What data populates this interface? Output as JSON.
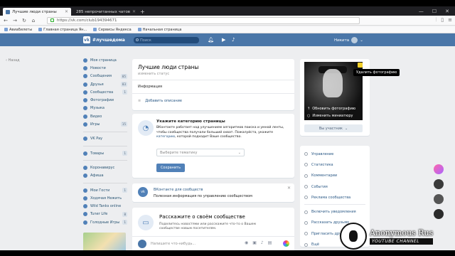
{
  "browser": {
    "tabs": [
      {
        "title": "Лучшие люди страны",
        "active": true
      },
      {
        "title": "285 непрочитанных чатов",
        "active": false
      }
    ],
    "url": "https://vk.com/club194394671",
    "bookmarks": [
      "Авиабилеты",
      "Главная страница Ян...",
      "Сервисы Яндекса",
      "Начальная страница"
    ]
  },
  "vk_header": {
    "logo_text": "#лучшедома",
    "search_placeholder": "Поиск",
    "user_name": "Никита"
  },
  "back_link": "Назад",
  "sidebar": {
    "items": [
      {
        "label": "Моя страница",
        "count": ""
      },
      {
        "label": "Новости",
        "count": ""
      },
      {
        "label": "Сообщения",
        "count": "85"
      },
      {
        "label": "Друзья",
        "count": "83"
      },
      {
        "label": "Сообщества",
        "count": "1"
      },
      {
        "label": "Фотографии",
        "count": ""
      },
      {
        "label": "Музыка",
        "count": ""
      },
      {
        "label": "Видео",
        "count": ""
      },
      {
        "label": "Игры",
        "count": "15"
      }
    ],
    "items2": [
      {
        "label": "VK Pay",
        "count": ""
      }
    ],
    "items3": [
      {
        "label": "Товары",
        "count": "1"
      }
    ],
    "items4": [
      {
        "label": "Коронавирус",
        "count": ""
      },
      {
        "label": "Афиша",
        "count": ""
      }
    ],
    "items5": [
      {
        "label": "Мои Гости",
        "count": "1"
      },
      {
        "label": "Ходячая Нежить",
        "count": ""
      },
      {
        "label": "Wild Tanks online",
        "count": ""
      },
      {
        "label": "Tuner Life",
        "count": "8"
      },
      {
        "label": "Голодные Игры",
        "count": "1"
      }
    ]
  },
  "group": {
    "name": "Лучшие люди страны",
    "status_placeholder": "изменить статус",
    "info_heading": "Информация",
    "add_description": "Добавить описание"
  },
  "category": {
    "heading": "Укажите категорию страницы",
    "text_before": "ВКонтакте работает над улучшением алгоритмов поиска и умной ленты, чтобы сообщества получали больший охват. Пожалуйста, укажите ",
    "text_link": "категорию",
    "text_after": ", которой подходит Ваше сообщество.",
    "select_placeholder": "Выберите тематику",
    "save_button": "Сохранить"
  },
  "vk_for_communities": {
    "title": "ВКонтакте для сообществ",
    "subtitle": "Полезная информация по управлению сообществом"
  },
  "tell": {
    "title": "Расскажите о своём сообществе",
    "text": "Поделитесь новостями или расскажите что-то о Вашем сообществе новым посетителям."
  },
  "post_placeholder": "Напишите что-нибудь...",
  "photo": {
    "update": "Обновить фотографию",
    "thumb": "Изменить миниатюру",
    "delete_tooltip": "Удалить фотографию"
  },
  "member_button": "Вы участник",
  "manage_menu": [
    "Управление",
    "Статистика",
    "Комментарии",
    "События",
    "Реклама сообщества"
  ],
  "manage_menu2": [
    "Включить уведомления",
    "Рассказать друзьям",
    "Пригласить друзей",
    "Ещё"
  ],
  "watermark": {
    "name": "Anonymous Rus",
    "channel": "YOUTUBE CHANNEL"
  },
  "colors": {
    "vk_blue": "#4a76a8",
    "page_bg": "#edeef0",
    "link": "#2a5885"
  }
}
